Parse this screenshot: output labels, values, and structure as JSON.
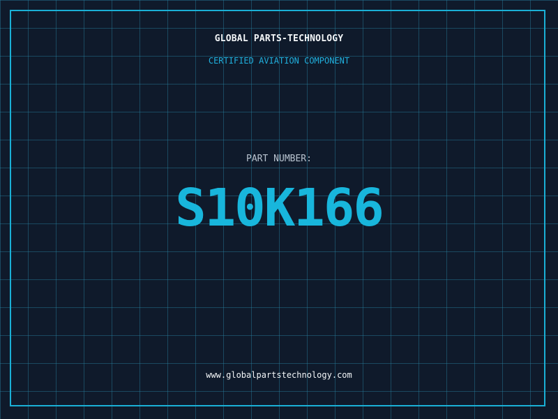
{
  "header": {
    "company": "GLOBAL PARTS-TECHNOLOGY",
    "tagline": "CERTIFIED AVIATION COMPONENT"
  },
  "part": {
    "label": "PART NUMBER:",
    "number": "S10K166"
  },
  "footer": {
    "website": "www.globalpartstechnology.com"
  },
  "colors": {
    "background": "#0f1a2b",
    "accent": "#18b6dc",
    "grid": "#2882a0",
    "text_primary": "#f2f5f7",
    "text_muted": "#b9c4d0"
  }
}
